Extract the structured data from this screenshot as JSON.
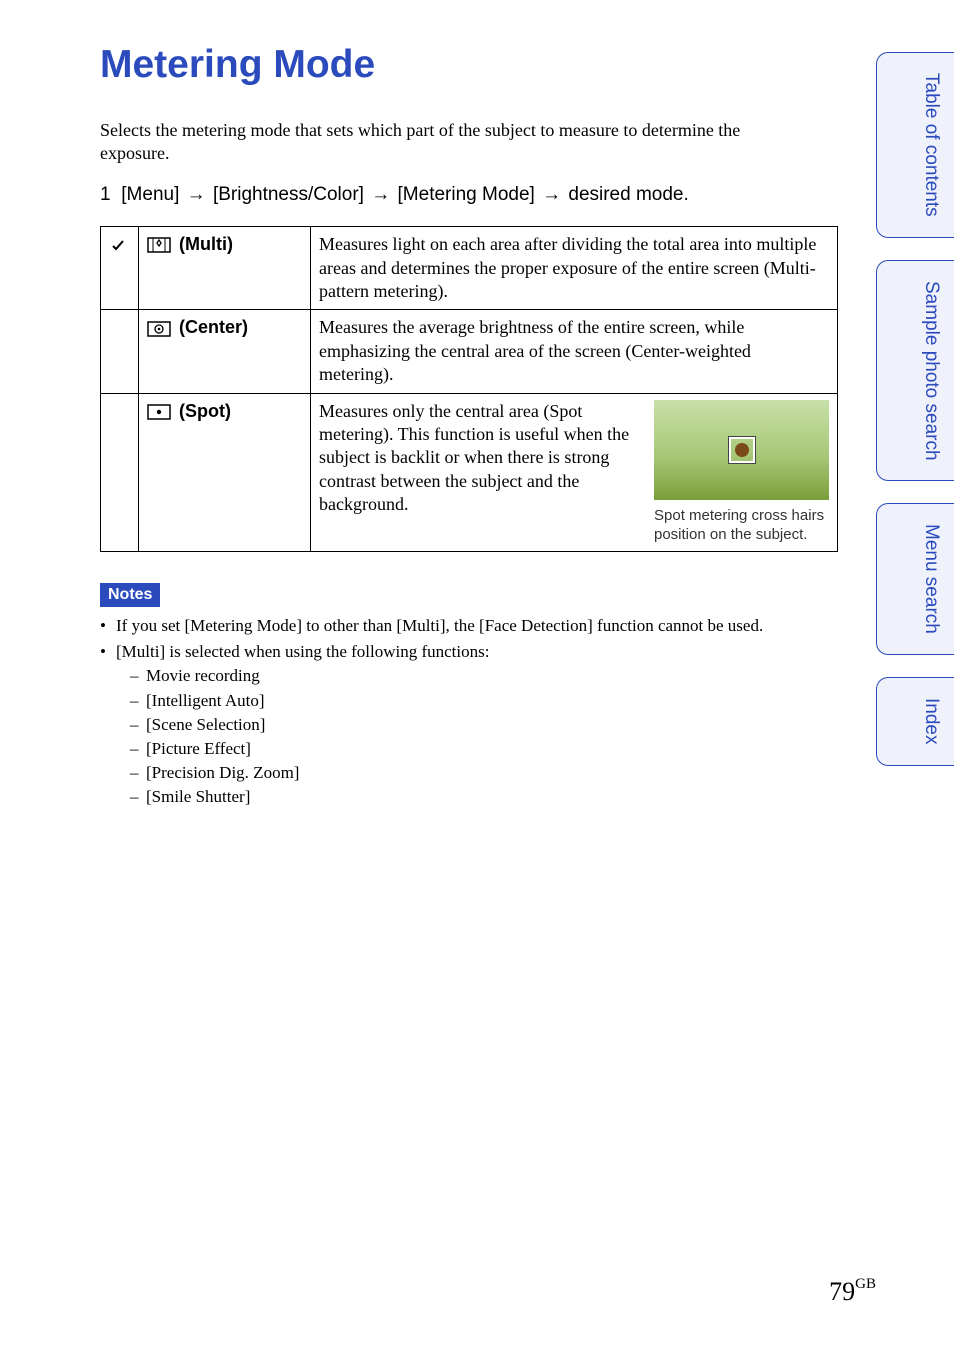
{
  "title": "Metering Mode",
  "intro": "Selects the metering mode that sets which part of the subject to measure to determine the exposure.",
  "step": {
    "num": "1",
    "path": [
      "[Menu]",
      "[Brightness/Color]",
      "[Metering Mode]",
      "desired mode."
    ]
  },
  "table": {
    "rows": [
      {
        "default": true,
        "label": "(Multi)",
        "desc": "Measures light on each area after dividing the total area into multiple areas and determines the proper exposure of the entire screen (Multi-pattern metering)."
      },
      {
        "default": false,
        "label": "(Center)",
        "desc": "Measures the average brightness of the entire screen, while emphasizing the central area of the screen (Center-weighted metering)."
      },
      {
        "default": false,
        "label": "(Spot)",
        "desc": "Measures only the central area (Spot metering). This function is useful when the subject is backlit or when there is strong contrast between the subject and the background.",
        "caption": "Spot metering cross hairs position on the subject."
      }
    ]
  },
  "notes": {
    "label": "Notes",
    "items": [
      {
        "text": "If you set [Metering Mode] to other than [Multi], the [Face Detection] function cannot be used."
      },
      {
        "text": "[Multi] is selected when using the following functions:",
        "sub": [
          "Movie recording",
          "[Intelligent Auto]",
          "[Scene Selection]",
          "[Picture Effect]",
          "[Precision Dig. Zoom]",
          "[Smile Shutter]"
        ]
      }
    ]
  },
  "tabs": [
    "Table of contents",
    "Sample photo search",
    "Menu search",
    "Index"
  ],
  "page": {
    "num": "79",
    "suffix": "GB"
  }
}
